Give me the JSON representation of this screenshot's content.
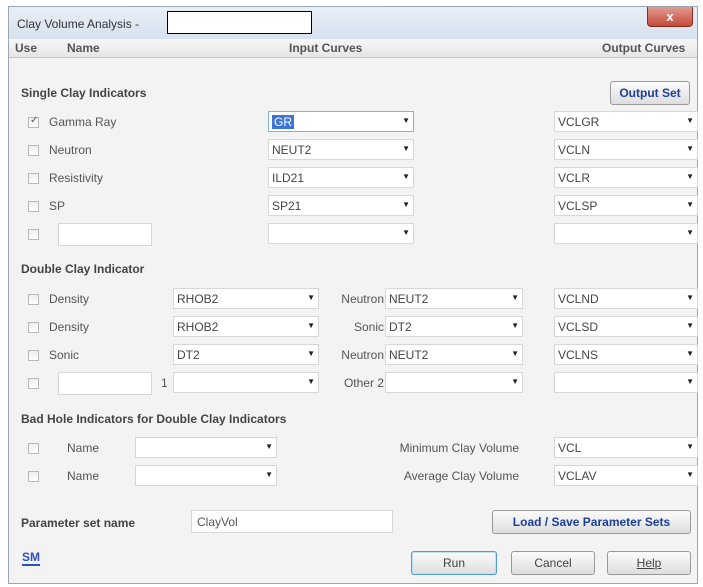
{
  "window": {
    "title": "Clay Volume Analysis -",
    "close": "x"
  },
  "header": {
    "use": "Use",
    "name": "Name",
    "input": "Input Curves",
    "output": "Output Curves"
  },
  "sections": {
    "single": "Single Clay Indicators",
    "double": "Double Clay Indicator",
    "badhole": "Bad Hole Indicators for Double Clay Indicators"
  },
  "output_set_label": "Output Set",
  "single_rows": [
    {
      "checked": true,
      "name": "Gamma Ray",
      "input": "GR",
      "output": "VCLGR"
    },
    {
      "checked": false,
      "name": "Neutron",
      "input": "NEUT2",
      "output": "VCLN"
    },
    {
      "checked": false,
      "name": "Resistivity",
      "input": "ILD21",
      "output": "VCLR"
    },
    {
      "checked": false,
      "name": "SP",
      "input": "SP21",
      "output": "VCLSP"
    },
    {
      "checked": false,
      "name": "",
      "input": "",
      "output": ""
    }
  ],
  "double_rows": [
    {
      "name": "Density",
      "input1": "RHOB2",
      "label2": "Neutron",
      "input2": "NEUT2",
      "output": "VCLND"
    },
    {
      "name": "Density",
      "input1": "RHOB2",
      "label2": "Sonic",
      "input2": "DT2",
      "output": "VCLSD"
    },
    {
      "name": "Sonic",
      "input1": "DT2",
      "label2": "Neutron",
      "input2": "NEUT2",
      "output": "VCLNS"
    },
    {
      "name": "",
      "mid": "1",
      "input1": "",
      "label2": "Other 2",
      "input2": "",
      "output": ""
    }
  ],
  "badhole_rows": [
    {
      "name": "Name",
      "value": "",
      "label": "Minimum Clay Volume",
      "output": "VCL"
    },
    {
      "name": "Name",
      "value": "",
      "label": "Average Clay Volume",
      "output": "VCLAV"
    }
  ],
  "param": {
    "label": "Parameter set name",
    "value": "ClayVol"
  },
  "buttons": {
    "load_save": "Load / Save Parameter Sets",
    "run": "Run",
    "cancel": "Cancel",
    "help": "Help",
    "sm": "SM"
  }
}
